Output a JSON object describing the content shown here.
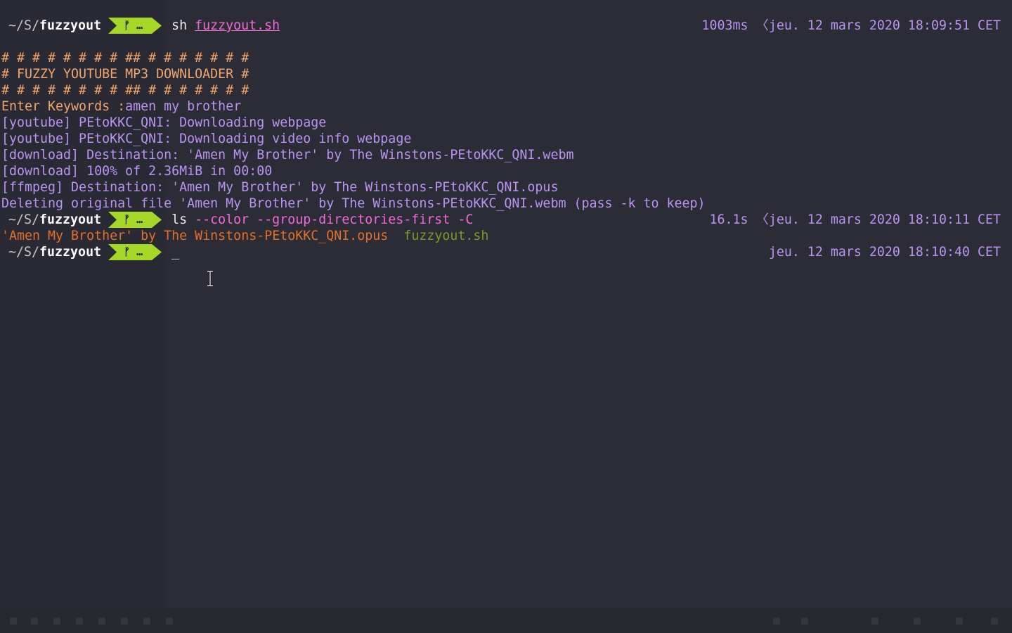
{
  "prompt": {
    "path_prefix": "~/S/",
    "path_dir": "fuzzyout",
    "git_glyph": "ᚠ …",
    "colors": {
      "git_segment": "#a6d628",
      "path": "#c6c6c6",
      "right_info": "#b994f0",
      "command_pink": "#f26ad6"
    }
  },
  "lines": {
    "cmd1": {
      "cmd": "sh",
      "arg": "fuzzyout.sh",
      "duration": "1003ms",
      "chevron": "〈",
      "timestamp": "jeu. 12 mars 2020 18:09:51 CET"
    },
    "banner1": "# # # # # # # # ## # # # # # # #",
    "banner2": "# FUZZY YOUTUBE MP3 DOWNLOADER #",
    "banner3": "# # # # # # # # ## # # # # # # #",
    "keywords_label": "Enter Keywords :",
    "keywords_value": "amen my brother",
    "out1": "[youtube] PEtoKKC_QNI: Downloading webpage",
    "out2": "[youtube] PEtoKKC_QNI: Downloading video info webpage",
    "out3": "[download] Destination: 'Amen My Brother' by The Winstons-PEtoKKC_QNI.webm",
    "out4": "[download] 100% of 2.36MiB in 00:00",
    "out5": "[ffmpeg] Destination: 'Amen My Brother' by The Winstons-PEtoKKC_QNI.opus",
    "out6": "Deleting original file 'Amen My Brother' by The Winstons-PEtoKKC_QNI.webm (pass -k to keep)",
    "cmd2": {
      "cmd": "ls",
      "args": " --color --group-directories-first -C",
      "duration": "16.1s",
      "chevron": "〈",
      "timestamp": "jeu. 12 mars 2020 18:10:11 CET"
    },
    "ls_file1": "'Amen My Brother' by The Winstons-PEtoKKC_QNI.opus",
    "ls_file2": "fuzzyout.sh",
    "cmd3": {
      "cursor": "_",
      "timestamp": "jeu. 12 mars 2020 18:10:40 CET"
    }
  }
}
